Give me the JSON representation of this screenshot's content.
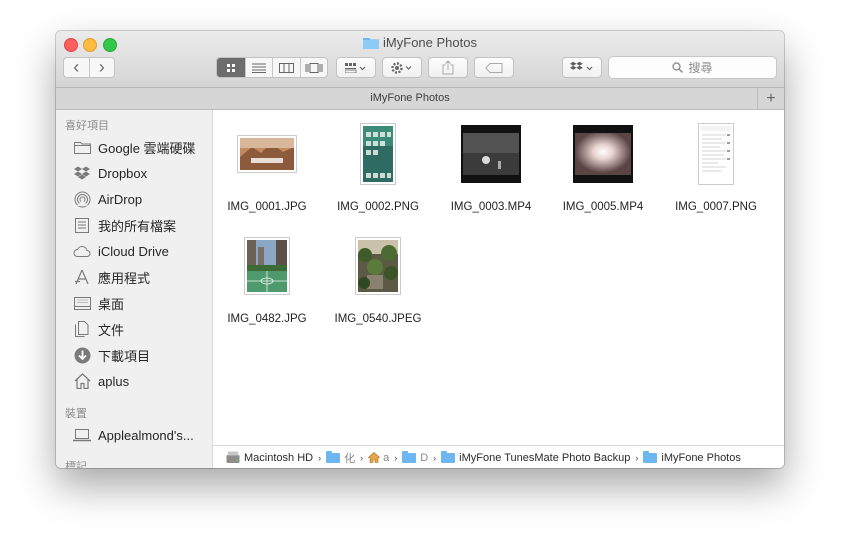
{
  "window": {
    "title": "iMyFone Photos"
  },
  "toolbar": {
    "back_glyph": "‹",
    "forward_glyph": "›",
    "search_placeholder": "搜尋"
  },
  "tab": {
    "label": "iMyFone Photos",
    "add_glyph": "+"
  },
  "sidebar": {
    "favorites_header": "喜好項目",
    "items": [
      {
        "label": "Google 雲端硬碟",
        "icon": "folder-icon"
      },
      {
        "label": "Dropbox",
        "icon": "dropbox-icon"
      },
      {
        "label": "AirDrop",
        "icon": "airdrop-icon"
      },
      {
        "label": "我的所有檔案",
        "icon": "all-files-icon"
      },
      {
        "label": "iCloud Drive",
        "icon": "cloud-icon"
      },
      {
        "label": "應用程式",
        "icon": "applications-icon"
      },
      {
        "label": "桌面",
        "icon": "desktop-icon"
      },
      {
        "label": "文件",
        "icon": "documents-icon"
      },
      {
        "label": "下載項目",
        "icon": "downloads-icon"
      },
      {
        "label": "aplus",
        "icon": "home-icon"
      }
    ],
    "devices_header": "裝置",
    "devices": [
      {
        "label": "Applealmond's...",
        "icon": "laptop-icon"
      }
    ],
    "tags_header": "標記"
  },
  "files": [
    {
      "name": "IMG_0001.JPG",
      "kind": "jpg-landscape"
    },
    {
      "name": "IMG_0002.PNG",
      "kind": "png-phone"
    },
    {
      "name": "IMG_0003.MP4",
      "kind": "video-dark"
    },
    {
      "name": "IMG_0005.MP4",
      "kind": "video-light"
    },
    {
      "name": "IMG_0007.PNG",
      "kind": "png-document"
    },
    {
      "name": "IMG_0482.JPG",
      "kind": "jpg-court"
    },
    {
      "name": "IMG_0540.JPEG",
      "kind": "jpg-garden"
    }
  ],
  "pathbar": {
    "root": "Macintosh HD",
    "seg1": "化",
    "seg2": "a",
    "seg3": "D",
    "seg4": "iMyFone TunesMate Photo Backup",
    "seg5": "iMyFone Photos",
    "separator": "›"
  },
  "colors": {
    "folder": "#6eb6ef",
    "active_segment": "#6d6d6d"
  }
}
